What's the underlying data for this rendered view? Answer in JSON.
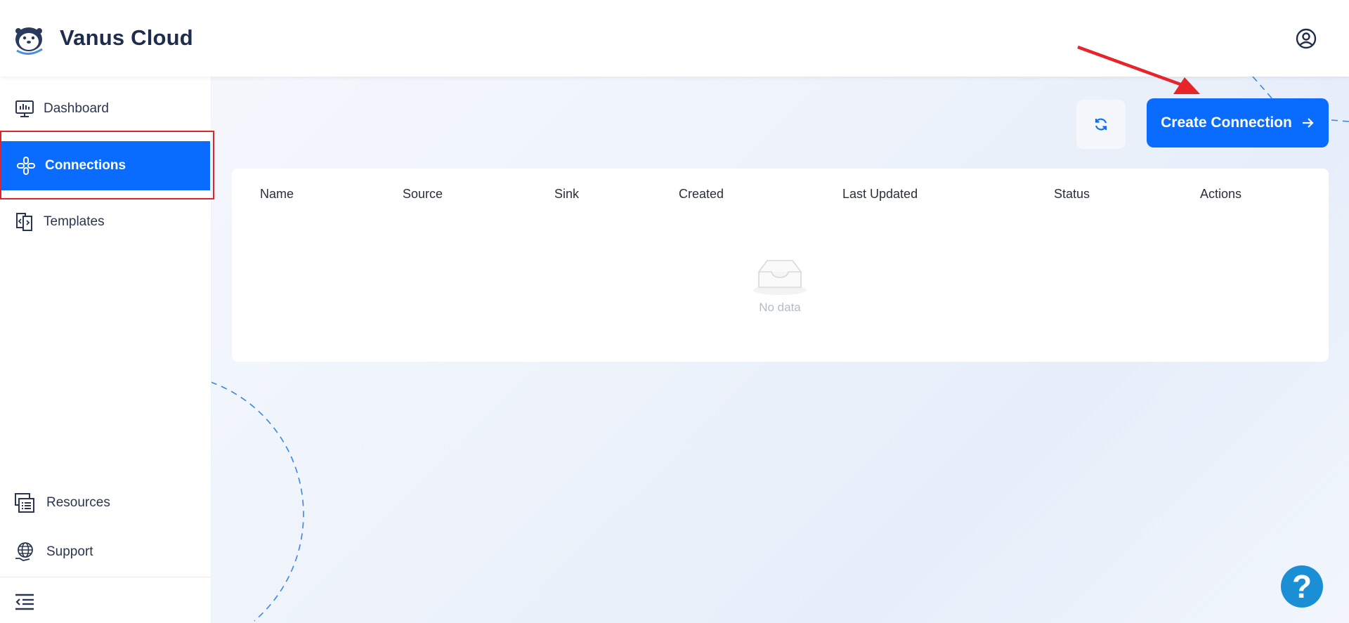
{
  "header": {
    "app_title": "Vanus Cloud",
    "logo_icon": "otter-logo-icon",
    "user_icon": "user-circle-icon"
  },
  "sidebar": {
    "items": [
      {
        "label": "Dashboard",
        "icon": "monitor-chart-icon",
        "active": false
      },
      {
        "label": "Connections",
        "icon": "connections-icon",
        "active": true
      },
      {
        "label": "Templates",
        "icon": "templates-icon",
        "active": false
      }
    ],
    "bottom_items": [
      {
        "label": "Resources",
        "icon": "list-icon"
      },
      {
        "label": "Support",
        "icon": "globe-hand-icon"
      }
    ],
    "collapse_icon": "collapse-menu-icon"
  },
  "toolbar": {
    "refresh_icon": "refresh-icon",
    "create_label": "Create Connection",
    "create_icon": "arrow-right-icon"
  },
  "table": {
    "columns": [
      "Name",
      "Source",
      "Sink",
      "Created",
      "Last Updated",
      "Status",
      "Actions"
    ],
    "rows": [],
    "empty_text": "No data"
  },
  "help": {
    "label": "?"
  },
  "colors": {
    "accent": "#0a6cff",
    "highlight_border": "#e0242b",
    "annotation_arrow": "#e8242b",
    "help_button": "#1a8fd6"
  }
}
